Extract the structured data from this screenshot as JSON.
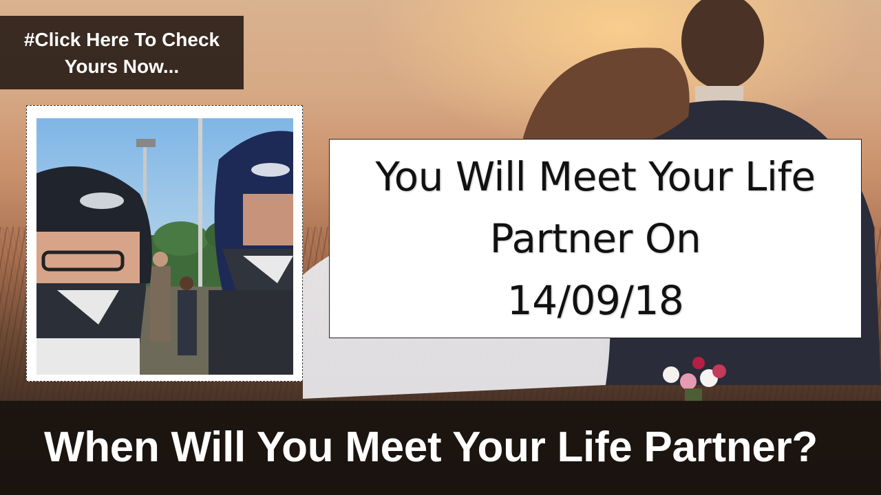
{
  "cta": {
    "line1": "#Click Here To Check",
    "line2": "Yours Now..."
  },
  "result": {
    "line1": "You Will Meet Your Life",
    "line2": "Partner On",
    "date": "14/09/18"
  },
  "footer": {
    "question": "When Will You Meet Your Life Partner?"
  },
  "colors": {
    "banner_bg": "#281c16",
    "bottom_bar": "#19120e",
    "result_bg": "#ffffff",
    "text_light": "#ffffff",
    "text_dark": "#111111"
  },
  "icons": {
    "profile_photo": "user-photo"
  }
}
